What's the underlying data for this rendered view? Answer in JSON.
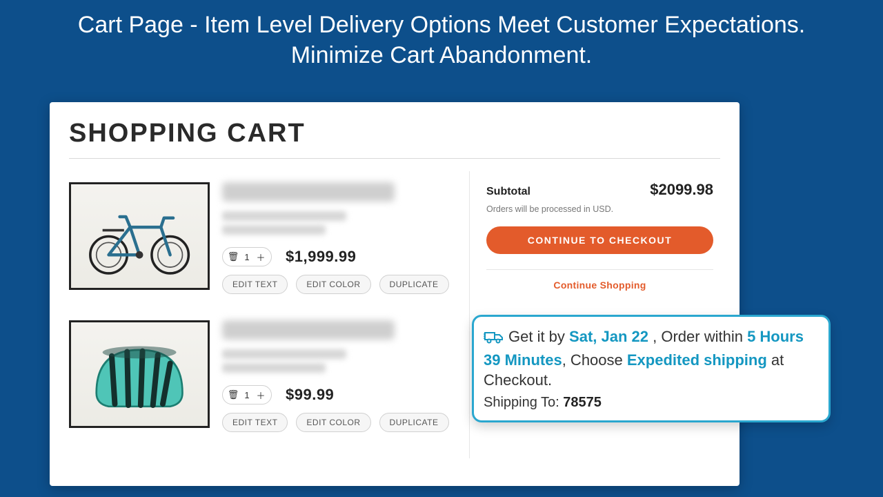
{
  "headline": {
    "line1": "Cart Page - Item Level Delivery Options Meet Customer Expectations.",
    "line2": "Minimize Cart Abandonment."
  },
  "cart": {
    "title": "SHOPPING CART",
    "items": [
      {
        "qty": "1",
        "price": "$1,999.99",
        "edit_text": "EDIT TEXT",
        "edit_color": "EDIT COLOR",
        "duplicate": "DUPLICATE"
      },
      {
        "qty": "1",
        "price": "$99.99",
        "edit_text": "EDIT TEXT",
        "edit_color": "EDIT COLOR",
        "duplicate": "DUPLICATE"
      }
    ],
    "summary": {
      "subtotal_label": "Subtotal",
      "subtotal_amount": "$2099.98",
      "currency_note": "Orders will be processed in USD.",
      "checkout_label": "CONTINUE TO CHECKOUT",
      "continue_label": "Continue Shopping"
    }
  },
  "callout": {
    "t1": "Get it by ",
    "date": "Sat, Jan 22 ",
    "t2": ", Order within ",
    "window": "5 Hours 39 Minutes",
    "t3": ", Choose ",
    "method": "Expedited shipping",
    "t4": " at Checkout.",
    "ship_label": "Shipping To: ",
    "zip": "78575"
  }
}
